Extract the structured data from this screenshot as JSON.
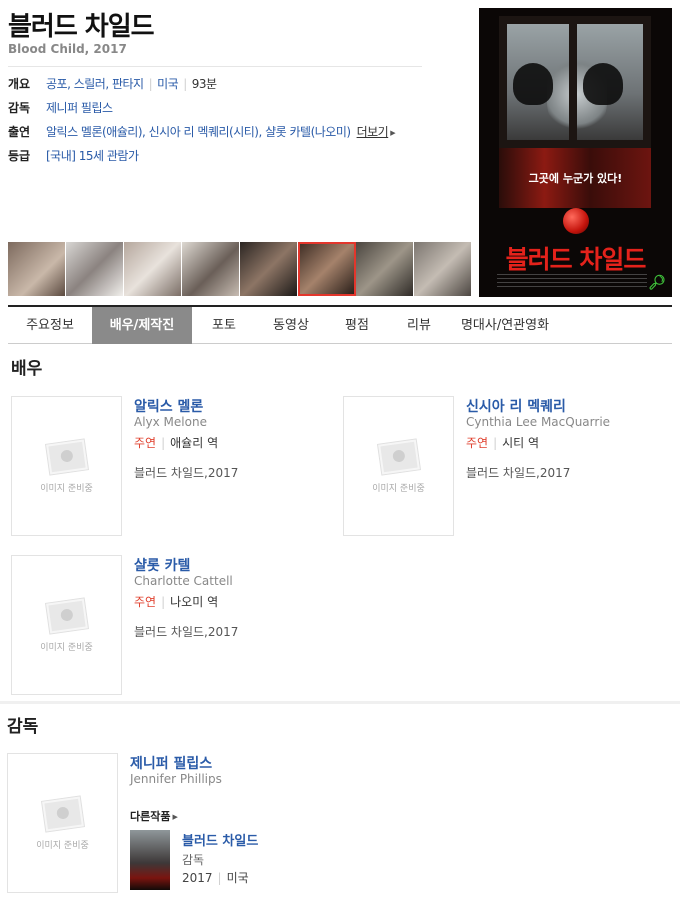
{
  "movie": {
    "title": "블러드 차일드",
    "subtitle": "Blood Child, 2017",
    "overview_label": "개요",
    "genres": "공포, 스릴러, 판타지",
    "country": "미국",
    "runtime": "93분",
    "director_label": "감독",
    "director": "제니퍼 필립스",
    "cast_label": "출연",
    "cast": "알릭스 멜론(애슐리), 신시아 리 멕퀘리(시티), 샬롯 카텔(나오미)",
    "more_label": "더보기",
    "rating_label": "등급",
    "rating": "[국내] 15세 관람가"
  },
  "poster": {
    "tagline": "그곳에 누군가 있다!",
    "title": "블러드 차일드",
    "accent": "#e4221b"
  },
  "stills": {
    "count": 8,
    "selected_index": 5
  },
  "tabs": [
    "주요정보",
    "배우/제작진",
    "포토",
    "동영상",
    "평점",
    "리뷰",
    "명대사/연관영화"
  ],
  "active_tab": "배우/제작진",
  "actors_section": {
    "title": "배우",
    "placeholder_text": "이미지 준비중",
    "lead_label": "주연",
    "actors": [
      {
        "name": "알릭스 멜론",
        "english": "Alyx Melone",
        "role": "애슐리 역",
        "film": "블러드 차일드,2017"
      },
      {
        "name": "신시아 리 멕퀘리",
        "english": "Cynthia Lee MacQuarrie",
        "role": "시티 역",
        "film": "블러드 차일드,2017"
      },
      {
        "name": "샬롯 카텔",
        "english": "Charlotte Cattell",
        "role": "나오미 역",
        "film": "블러드 차일드,2017"
      }
    ]
  },
  "director_section": {
    "title": "감독",
    "name": "제니퍼 필립스",
    "english": "Jennifer Phillips",
    "placeholder_text": "이미지 준비중",
    "other_works_label": "다른작품",
    "work": {
      "title": "블러드 차일드",
      "role": "감독",
      "year": "2017",
      "country": "미국"
    }
  },
  "colors": {
    "link": "#2a5ba8",
    "lead": "#e0412f",
    "active_tab": "#8a8a8a"
  }
}
